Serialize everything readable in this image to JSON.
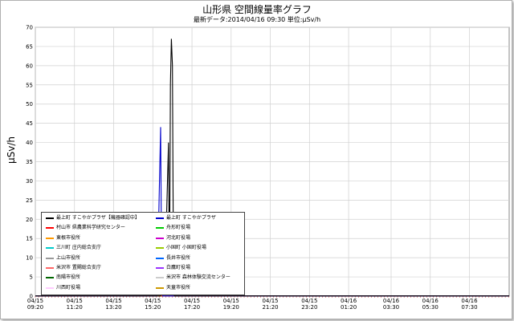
{
  "title": "山形県 空間線量率グラフ",
  "subtitle": "最新データ:2014/04/16 09:30  単位:μSv/h",
  "chart_data": {
    "type": "line",
    "ylabel": "μSv/h",
    "ylim": [
      0,
      70
    ],
    "yticks": [
      0,
      5,
      10,
      15,
      20,
      25,
      30,
      35,
      40,
      45,
      50,
      55,
      60,
      65,
      70
    ],
    "x_ticks": [
      {
        "date": "04/15",
        "time": "09:20"
      },
      {
        "date": "04/15",
        "time": "11:20"
      },
      {
        "date": "04/15",
        "time": "13:20"
      },
      {
        "date": "04/15",
        "time": "15:20"
      },
      {
        "date": "04/15",
        "time": "17:20"
      },
      {
        "date": "04/15",
        "time": "19:20"
      },
      {
        "date": "04/15",
        "time": "21:20"
      },
      {
        "date": "04/15",
        "time": "23:20"
      },
      {
        "date": "04/16",
        "time": "01:20"
      },
      {
        "date": "04/16",
        "time": "03:30"
      },
      {
        "date": "04/16",
        "time": "05:30"
      },
      {
        "date": "04/16",
        "time": "07:30"
      }
    ],
    "x_range_hours": [
      0,
      24.2
    ],
    "series": [
      {
        "name": "最上町 すこやかプラザ【機器確認中】",
        "color": "#000000",
        "points": [
          [
            0,
            0.05
          ],
          [
            6.4,
            0.05
          ],
          [
            6.55,
            3
          ],
          [
            6.7,
            20
          ],
          [
            6.8,
            40
          ],
          [
            6.85,
            2
          ],
          [
            6.9,
            55
          ],
          [
            6.95,
            67
          ],
          [
            7.0,
            60
          ],
          [
            7.05,
            10
          ],
          [
            7.1,
            0.05
          ],
          [
            24.2,
            0.05
          ]
        ]
      },
      {
        "name": "最上町 すこやかプラザ",
        "color": "#0000cc",
        "points": [
          [
            0,
            0.05
          ],
          [
            6.2,
            0.05
          ],
          [
            6.3,
            20
          ],
          [
            6.4,
            44
          ],
          [
            6.45,
            5
          ],
          [
            6.5,
            0.05
          ],
          [
            24.2,
            0.05
          ]
        ]
      },
      {
        "name": "村山市 県農業科学研究センター",
        "color": "#ff0000",
        "points": [
          [
            0,
            0.05
          ],
          [
            24.2,
            0.05
          ]
        ]
      },
      {
        "name": "舟形町役場",
        "color": "#00cc00",
        "points": [
          [
            0,
            0.05
          ],
          [
            24.2,
            0.05
          ]
        ]
      },
      {
        "name": "東根市役所",
        "color": "#ff9900",
        "points": [
          [
            0,
            0.05
          ],
          [
            24.2,
            0.05
          ]
        ]
      },
      {
        "name": "河北町役場",
        "color": "#cc00cc",
        "points": [
          [
            0,
            0.05
          ],
          [
            24.2,
            0.05
          ]
        ]
      },
      {
        "name": "三川町 庄内総合支庁",
        "color": "#00cccc",
        "points": [
          [
            0,
            0.05
          ],
          [
            24.2,
            0.05
          ]
        ]
      },
      {
        "name": "小国町 小国町役場",
        "color": "#99cc00",
        "points": [
          [
            0,
            0.05
          ],
          [
            24.2,
            0.05
          ]
        ]
      },
      {
        "name": "上山市役所",
        "color": "#999999",
        "points": [
          [
            0,
            0.05
          ],
          [
            24.2,
            0.05
          ]
        ]
      },
      {
        "name": "長井市役所",
        "color": "#0066ff",
        "points": [
          [
            0,
            0.05
          ],
          [
            24.2,
            0.05
          ]
        ]
      },
      {
        "name": "米沢市 置賜総合支庁",
        "color": "#ff6666",
        "points": [
          [
            0,
            0.05
          ],
          [
            24.2,
            0.05
          ]
        ]
      },
      {
        "name": "白鷹町役場",
        "color": "#9933ff",
        "points": [
          [
            0,
            0.05
          ],
          [
            24.2,
            0.05
          ]
        ]
      },
      {
        "name": "南陽市役所",
        "color": "#006600",
        "points": [
          [
            0,
            0.05
          ],
          [
            24.2,
            0.05
          ]
        ]
      },
      {
        "name": "米沢市 森林体験交流センター",
        "color": "#cccccc",
        "points": [
          [
            0,
            0.05
          ],
          [
            24.2,
            0.05
          ]
        ]
      },
      {
        "name": "川西町役場",
        "color": "#ffccff",
        "points": [
          [
            0,
            0.05
          ],
          [
            24.2,
            0.05
          ]
        ]
      },
      {
        "name": "天童市役所",
        "color": "#cc9900",
        "points": [
          [
            0,
            0.05
          ],
          [
            24.2,
            0.05
          ]
        ]
      }
    ],
    "grid": true,
    "legend_position": "bottom-left"
  }
}
